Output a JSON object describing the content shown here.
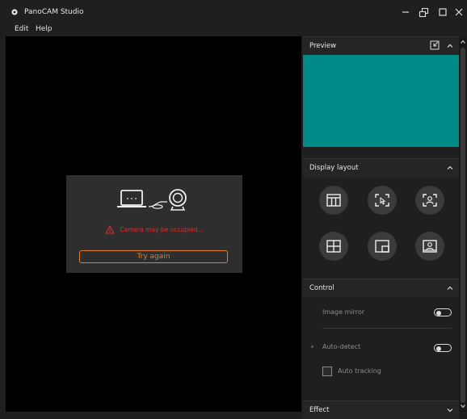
{
  "app": {
    "title": "PanoCAM Studio"
  },
  "menu": {
    "items": [
      "Edit",
      "Help"
    ]
  },
  "camera": {
    "warning": "Camera may be occupied...",
    "retry_label": "Try again"
  },
  "panel": {
    "preview": {
      "title": "Preview"
    },
    "display_layout": {
      "title": "Display layout"
    },
    "control": {
      "title": "Control",
      "image_mirror_label": "Image mirror",
      "image_mirror_on": false,
      "auto_detect_label": "Auto-detect",
      "auto_detect_on": false,
      "auto_tracking_label": "Auto tracking",
      "auto_tracking_checked": false
    },
    "effect": {
      "title": "Effect"
    }
  },
  "colors": {
    "preview": "#008a88",
    "accent": "#e67e22",
    "warning": "#e02b2b"
  }
}
